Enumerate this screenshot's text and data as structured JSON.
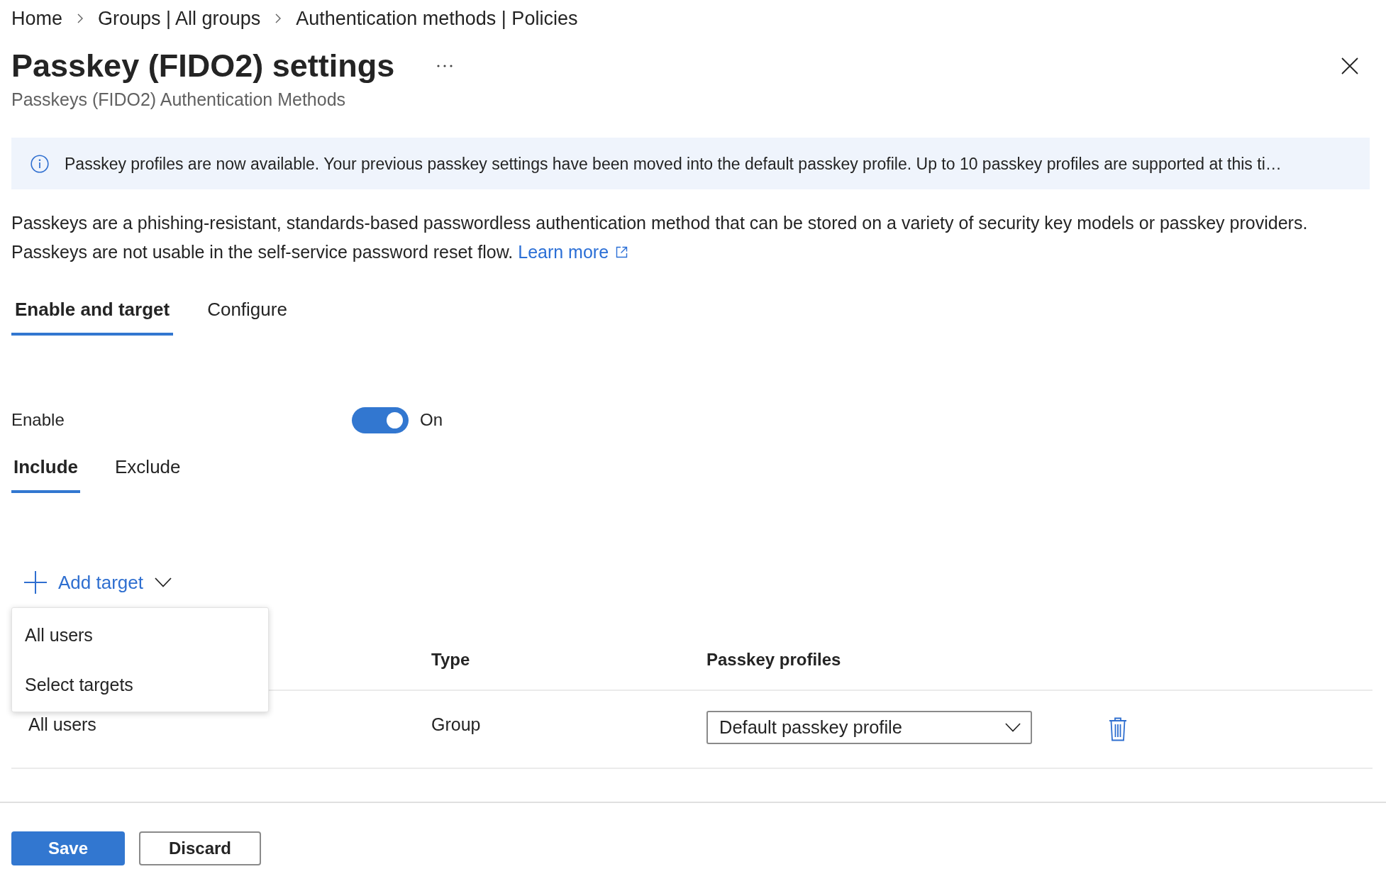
{
  "breadcrumb": [
    {
      "label": "Home"
    },
    {
      "label": "Groups | All groups"
    },
    {
      "label": "Authentication methods | Policies"
    }
  ],
  "header": {
    "title": "Passkey (FIDO2) settings",
    "subtitle": "Passkeys (FIDO2) Authentication Methods"
  },
  "info_banner": {
    "text": "Passkey profiles are now available. Your previous passkey settings have been moved into the default passkey profile. Up to 10 passkey profiles are supported at this ti…"
  },
  "description": {
    "text": "Passkeys are a phishing-resistant, standards-based passwordless authentication method that can be stored on a variety of security key models or passkey providers. Passkeys are not usable in the self-service password reset flow.",
    "link": "Learn more"
  },
  "tabs": [
    {
      "label": "Enable and target",
      "selected": true
    },
    {
      "label": "Configure",
      "selected": false
    }
  ],
  "enable": {
    "label": "Enable",
    "on": true,
    "state_label": "On"
  },
  "target_tabs": [
    {
      "label": "Include",
      "selected": true
    },
    {
      "label": "Exclude",
      "selected": false
    }
  ],
  "add_target": {
    "label": "Add target",
    "menu": {
      "expanded": true,
      "items": [
        {
          "label": "All users"
        },
        {
          "label": "Select targets"
        }
      ]
    }
  },
  "table": {
    "columns": [
      {
        "label": "Type"
      },
      {
        "label": "Passkey profiles"
      }
    ],
    "rows": [
      {
        "column_1": "All users",
        "type": "Group",
        "passkey_profile": "Default passkey profile"
      }
    ]
  },
  "footer": {
    "buttons": [
      {
        "label": "Save",
        "kind": "primary"
      },
      {
        "label": "Discard",
        "kind": "secondary"
      }
    ]
  }
}
